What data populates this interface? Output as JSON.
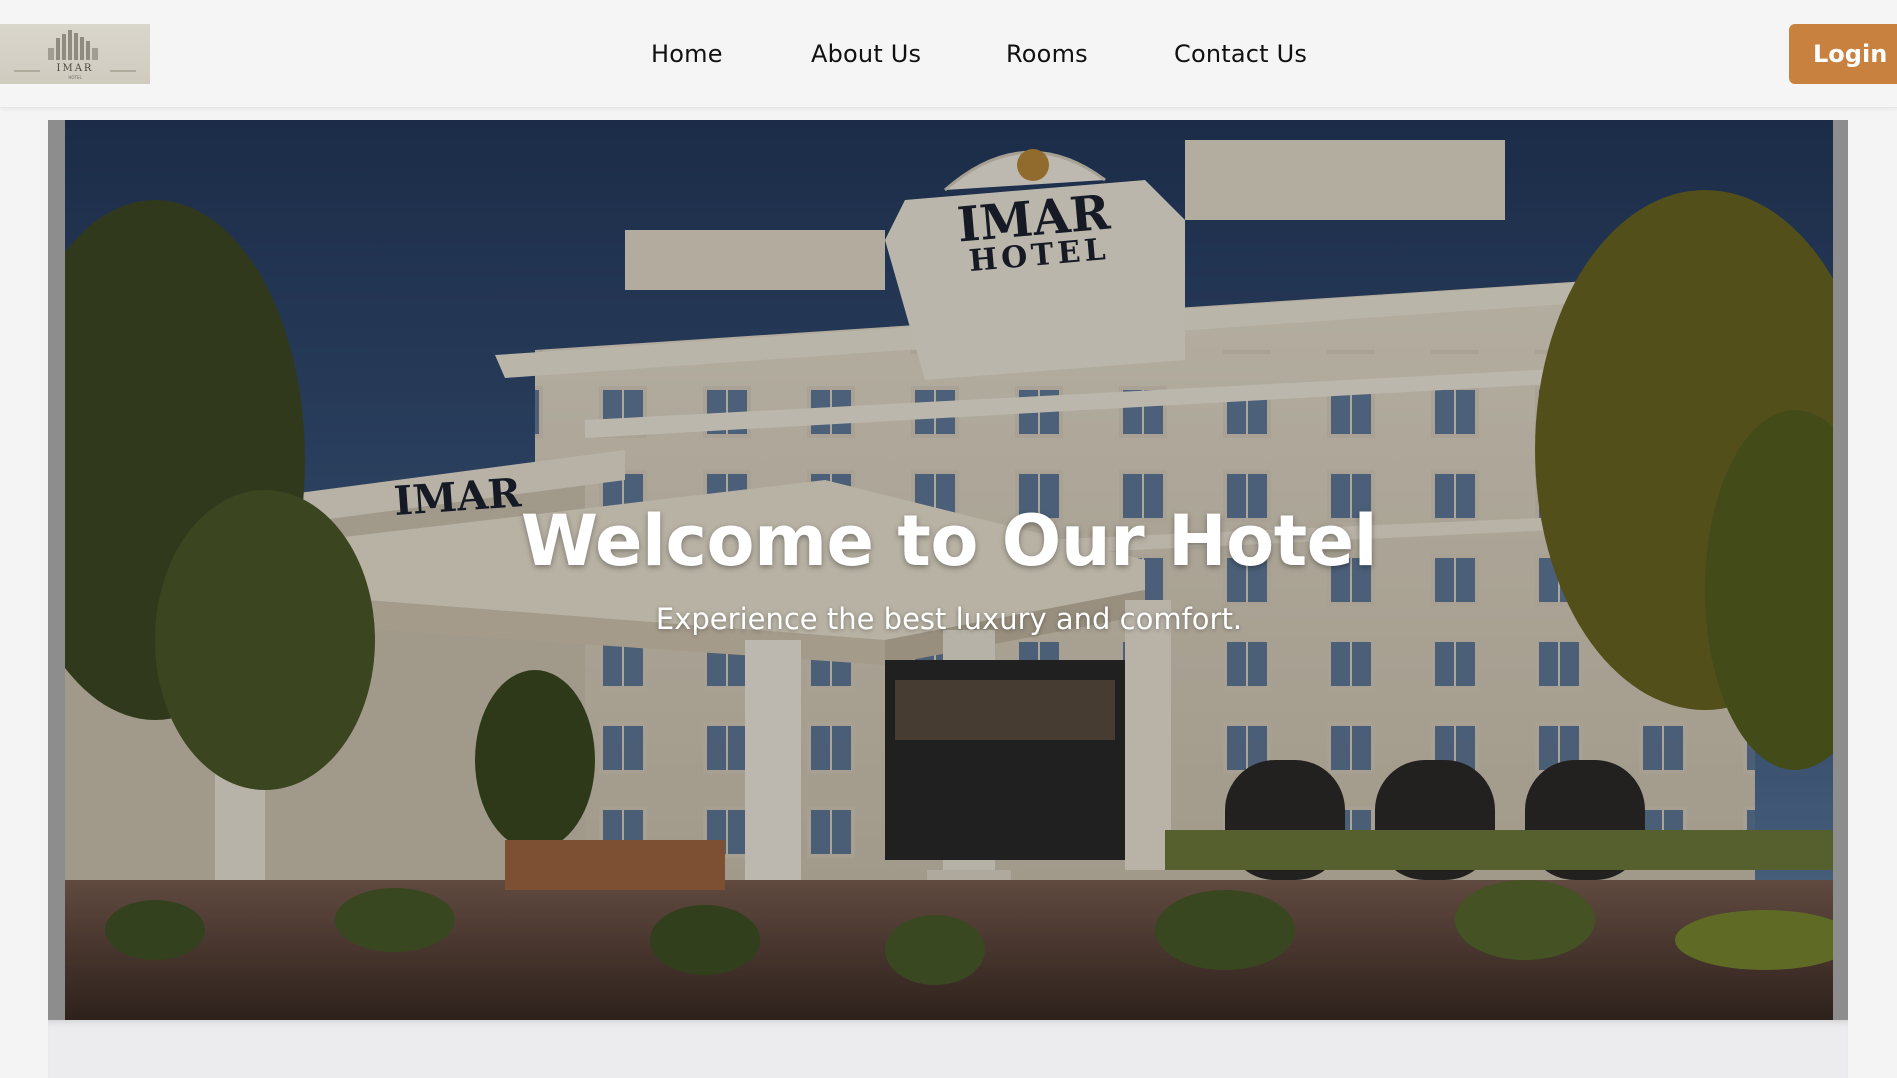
{
  "header": {
    "logo_text": "IMAR",
    "nav": [
      {
        "label": "Home"
      },
      {
        "label": "About Us"
      },
      {
        "label": "Rooms"
      },
      {
        "label": "Contact Us"
      }
    ],
    "login_label": "Login"
  },
  "hero": {
    "title": "Welcome to Our Hotel",
    "subtitle": "Experience the best luxury and comfort.",
    "image_sign_main": "IMAR",
    "image_sign_sub": "HOTEL",
    "image_canopy_sign": "IMAR"
  },
  "colors": {
    "accent": "#c8813e",
    "header_bg": "#f5f5f5",
    "page_bg": "#f4f4f4"
  },
  "icons": {
    "logo": "hotel-building-logo"
  }
}
